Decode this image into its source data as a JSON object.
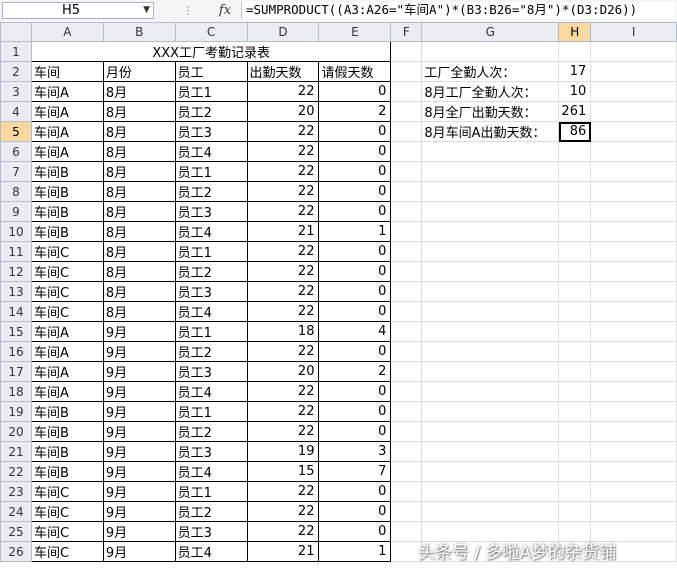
{
  "formula_bar": {
    "name_box": "H5",
    "fx": "fx",
    "formula": "=SUMPRODUCT((A3:A26=\"车间A\")*(B3:B26=\"8月\")*(D3:D26))"
  },
  "columns": [
    "A",
    "B",
    "C",
    "D",
    "E",
    "F",
    "G",
    "H",
    "I"
  ],
  "selected_column": "H",
  "selected_row": 5,
  "table": {
    "title": "XXX工厂考勤记录表",
    "headers": [
      "车间",
      "月份",
      "员工",
      "出勤天数",
      "请假天数"
    ],
    "rows": [
      [
        "车间A",
        "8月",
        "员工1",
        22,
        0
      ],
      [
        "车间A",
        "8月",
        "员工2",
        20,
        2
      ],
      [
        "车间A",
        "8月",
        "员工3",
        22,
        0
      ],
      [
        "车间A",
        "8月",
        "员工4",
        22,
        0
      ],
      [
        "车间B",
        "8月",
        "员工1",
        22,
        0
      ],
      [
        "车间B",
        "8月",
        "员工2",
        22,
        0
      ],
      [
        "车间B",
        "8月",
        "员工3",
        22,
        0
      ],
      [
        "车间B",
        "8月",
        "员工4",
        21,
        1
      ],
      [
        "车间C",
        "8月",
        "员工1",
        22,
        0
      ],
      [
        "车间C",
        "8月",
        "员工2",
        22,
        0
      ],
      [
        "车间C",
        "8月",
        "员工3",
        22,
        0
      ],
      [
        "车间C",
        "8月",
        "员工4",
        22,
        0
      ],
      [
        "车间A",
        "9月",
        "员工1",
        18,
        4
      ],
      [
        "车间A",
        "9月",
        "员工2",
        22,
        0
      ],
      [
        "车间A",
        "9月",
        "员工3",
        20,
        2
      ],
      [
        "车间A",
        "9月",
        "员工4",
        22,
        0
      ],
      [
        "车间B",
        "9月",
        "员工1",
        22,
        0
      ],
      [
        "车间B",
        "9月",
        "员工2",
        22,
        0
      ],
      [
        "车间B",
        "9月",
        "员工3",
        19,
        3
      ],
      [
        "车间B",
        "9月",
        "员工4",
        15,
        7
      ],
      [
        "车间C",
        "9月",
        "员工1",
        22,
        0
      ],
      [
        "车间C",
        "9月",
        "员工2",
        22,
        0
      ],
      [
        "车间C",
        "9月",
        "员工3",
        22,
        0
      ],
      [
        "车间C",
        "9月",
        "员工4",
        21,
        1
      ]
    ]
  },
  "summary": [
    {
      "label": "工厂全勤人次：",
      "value": 17
    },
    {
      "label": "8月工厂全勤人次：",
      "value": 10
    },
    {
      "label": "8月全厂出勤天数：",
      "value": 261
    },
    {
      "label": "8月车间A出勤天数：",
      "value": 86
    }
  ],
  "watermark": "头条号 / 多啦A梦的杂货铺"
}
